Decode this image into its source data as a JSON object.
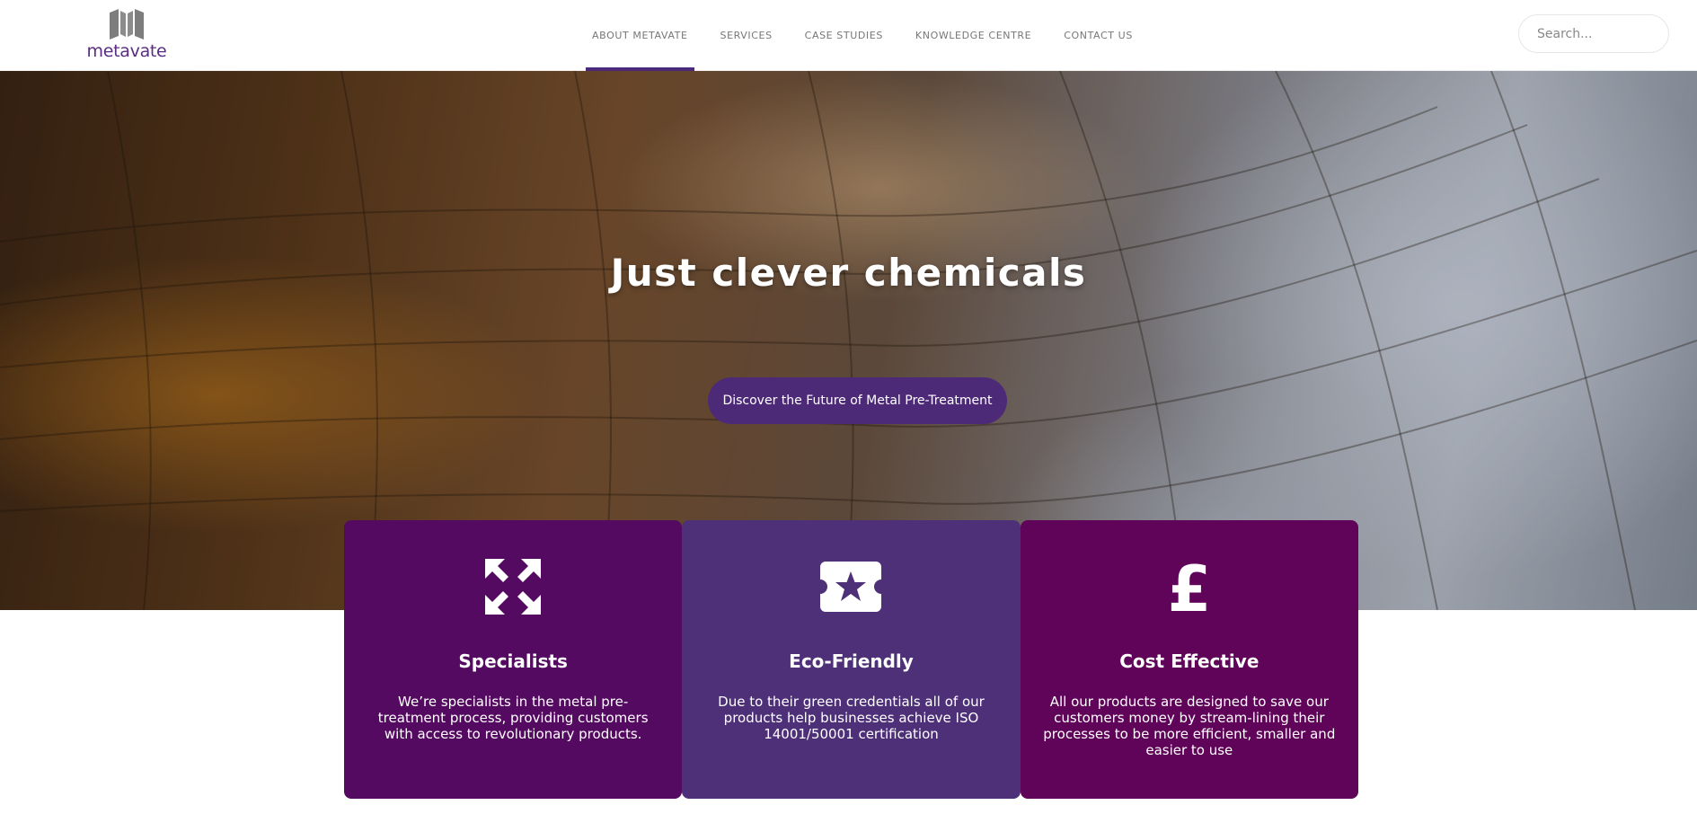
{
  "header": {
    "logo_text": "metavate",
    "nav": [
      {
        "label": "ABOUT METAVATE",
        "active": true
      },
      {
        "label": "SERVICES",
        "active": false
      },
      {
        "label": "CASE STUDIES",
        "active": false
      },
      {
        "label": "KNOWLEDGE CENTRE",
        "active": false
      },
      {
        "label": "CONTACT US",
        "active": false
      }
    ],
    "search_placeholder": "Search..."
  },
  "hero": {
    "title": "Just clever chemicals",
    "cta_label": "Discover the Future of Metal Pre-Treatment"
  },
  "features": [
    {
      "icon": "expand-arrows-icon",
      "title": "Specialists",
      "text": "We’re specialists in the metal pre-treatment process, providing customers with access to revolutionary products.",
      "color": "#550a61"
    },
    {
      "icon": "star-ticket-icon",
      "title": "Eco-Friendly",
      "text": "Due to their green credentials all of our products help businesses achieve ISO 14001/50001 certification",
      "color": "#4d3077"
    },
    {
      "icon": "pound-sign-icon",
      "title": "Cost Effective",
      "text": "All our products are designed to save our customers money by stream-lining their processes to be more efficient, smaller and easier to use",
      "color": "#5f0458"
    }
  ],
  "colors": {
    "brand_purple": "#4d2a78",
    "nav_text": "#777777"
  }
}
